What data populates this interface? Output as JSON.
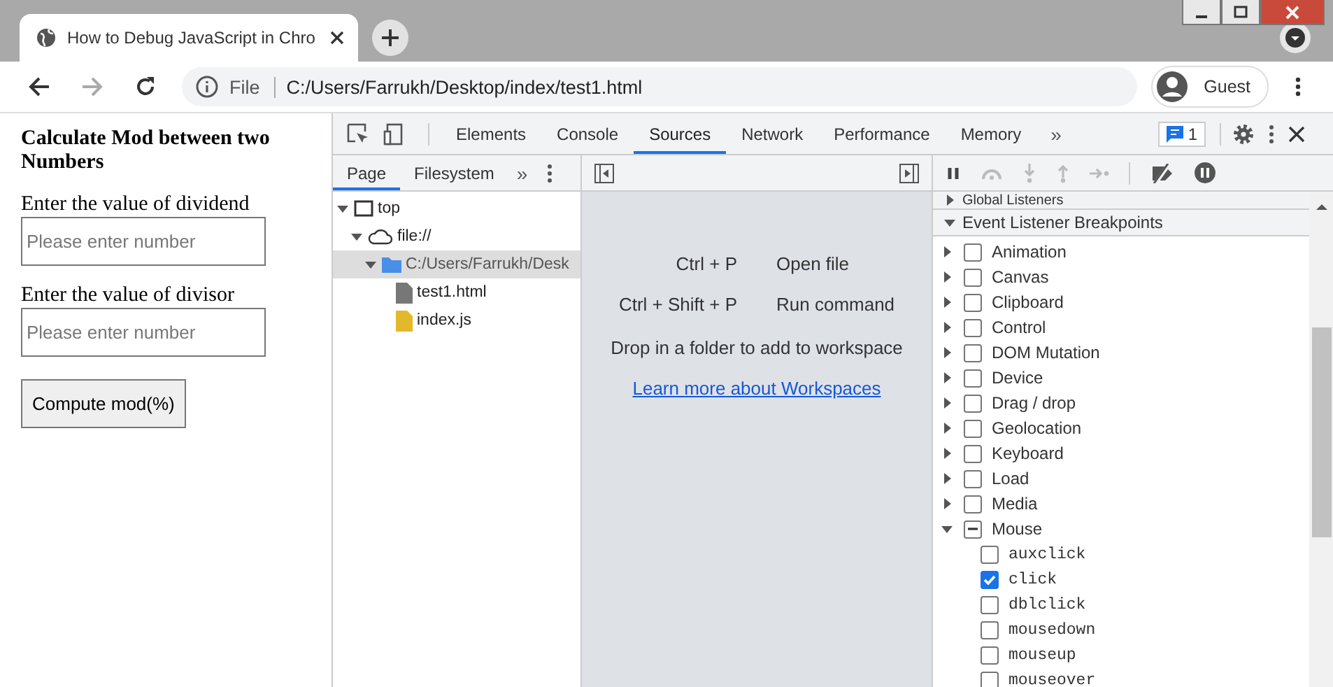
{
  "browser": {
    "tab_title": "How to Debug JavaScript in Chro",
    "address_scheme": "File",
    "address": "C:/Users/Farrukh/Desktop/index/test1.html",
    "profile": "Guest"
  },
  "page": {
    "heading": "Calculate Mod between two Numbers",
    "fields": [
      {
        "label": "Enter the value of dividend",
        "placeholder": "Please enter number"
      },
      {
        "label": "Enter the value of divisor",
        "placeholder": "Please enter number"
      }
    ],
    "button": "Compute mod(%)"
  },
  "devtools": {
    "tabs": [
      {
        "label": "Elements",
        "selected": false
      },
      {
        "label": "Console",
        "selected": false
      },
      {
        "label": "Sources",
        "selected": true
      },
      {
        "label": "Network",
        "selected": false
      },
      {
        "label": "Performance",
        "selected": false
      },
      {
        "label": "Memory",
        "selected": false
      }
    ],
    "more_tabs": "»",
    "issues_count": "1",
    "navigator_tabs": [
      {
        "label": "Page",
        "selected": true
      },
      {
        "label": "Filesystem",
        "selected": false
      }
    ],
    "navigator_more": "»",
    "tree": [
      {
        "label": "top",
        "kind": "frame",
        "expanded": true,
        "selected": false,
        "children": [
          {
            "label": "file://",
            "kind": "cloud",
            "expanded": true,
            "selected": false,
            "children": [
              {
                "label": "C:/Users/Farrukh/Desk",
                "kind": "folder",
                "expanded": true,
                "selected": true,
                "children": [
                  {
                    "label": "test1.html",
                    "kind": "html",
                    "selected": false
                  },
                  {
                    "label": "index.js",
                    "kind": "js",
                    "selected": false
                  }
                ]
              }
            ]
          }
        ]
      }
    ],
    "shortcuts": [
      {
        "keys": "Ctrl + P",
        "action": "Open file"
      },
      {
        "keys": "Ctrl + Shift + P",
        "action": "Run command"
      }
    ],
    "drop_hint": "Drop in a folder to add to workspace",
    "workspaces_link": "Learn more about Workspaces",
    "sections": [
      {
        "label": "Global Listeners",
        "expanded": false
      },
      {
        "label": "Event Listener Breakpoints",
        "expanded": true
      }
    ],
    "breakpoints": [
      {
        "label": "Animation",
        "expanded": false,
        "checked": false,
        "indeterminate": false
      },
      {
        "label": "Canvas",
        "expanded": false,
        "checked": false,
        "indeterminate": false
      },
      {
        "label": "Clipboard",
        "expanded": false,
        "checked": false,
        "indeterminate": false
      },
      {
        "label": "Control",
        "expanded": false,
        "checked": false,
        "indeterminate": false
      },
      {
        "label": "DOM Mutation",
        "expanded": false,
        "checked": false,
        "indeterminate": false
      },
      {
        "label": "Device",
        "expanded": false,
        "checked": false,
        "indeterminate": false
      },
      {
        "label": "Drag / drop",
        "expanded": false,
        "checked": false,
        "indeterminate": false
      },
      {
        "label": "Geolocation",
        "expanded": false,
        "checked": false,
        "indeterminate": false
      },
      {
        "label": "Keyboard",
        "expanded": false,
        "checked": false,
        "indeterminate": false
      },
      {
        "label": "Load",
        "expanded": false,
        "checked": false,
        "indeterminate": false
      },
      {
        "label": "Media",
        "expanded": false,
        "checked": false,
        "indeterminate": false
      },
      {
        "label": "Mouse",
        "expanded": true,
        "checked": false,
        "indeterminate": true,
        "children": [
          {
            "label": "auxclick",
            "checked": false
          },
          {
            "label": "click",
            "checked": true
          },
          {
            "label": "dblclick",
            "checked": false
          },
          {
            "label": "mousedown",
            "checked": false
          },
          {
            "label": "mouseup",
            "checked": false
          },
          {
            "label": "mouseover",
            "checked": false
          }
        ]
      }
    ]
  }
}
